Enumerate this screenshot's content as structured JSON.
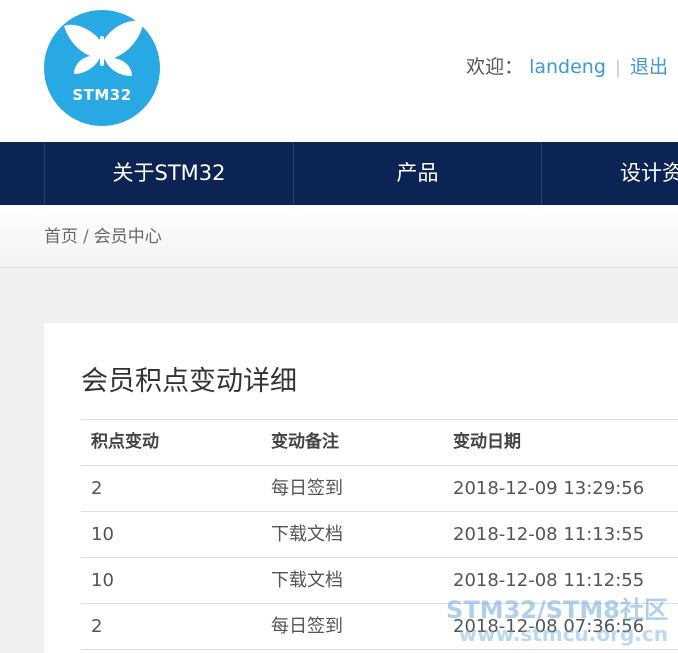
{
  "header": {
    "logo_text": "STM32",
    "welcome_label": "欢迎：",
    "username": "landeng",
    "separator": "|",
    "logout_label": "退出"
  },
  "nav": {
    "items": [
      {
        "label": "关于STM32"
      },
      {
        "label": "产品"
      },
      {
        "label": "设计资"
      }
    ]
  },
  "breadcrumb": {
    "home": "首页",
    "separator": "/",
    "current": "会员中心"
  },
  "panel": {
    "title": "会员积点变动详细",
    "table": {
      "columns": [
        "积点变动",
        "变动备注",
        "变动日期"
      ],
      "rows": [
        [
          "2",
          "每日签到",
          "2018-12-09 13:29:56"
        ],
        [
          "10",
          "下载文档",
          "2018-12-08 11:13:55"
        ],
        [
          "10",
          "下载文档",
          "2018-12-08 11:12:55"
        ],
        [
          "2",
          "每日签到",
          "2018-12-08 07:36:56"
        ]
      ]
    }
  },
  "watermark": {
    "line1": "STM32/STM8社区",
    "line2": "www.stmcu.org.cn"
  },
  "colors": {
    "nav_background": "#0c2453",
    "link_blue": "#3d9bd1",
    "logo_blue": "#29a9e3"
  }
}
